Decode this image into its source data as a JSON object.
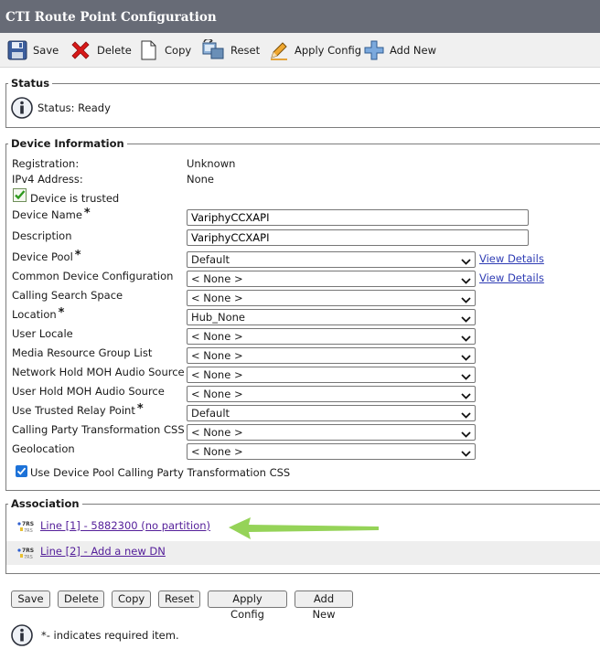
{
  "window": {
    "title": "CTI Route Point Configuration"
  },
  "toolbar": {
    "save": "Save",
    "delete": "Delete",
    "copy": "Copy",
    "reset": "Reset",
    "apply_config": "Apply Config",
    "add_new": "Add New"
  },
  "status": {
    "legend": "Status",
    "text": "Status: Ready"
  },
  "device_info": {
    "legend": "Device Information",
    "registration_label": "Registration:",
    "registration_value": "Unknown",
    "ipv4_label": "IPv4 Address:",
    "ipv4_value": "None",
    "trusted_label": "Device is trusted",
    "device_name_label": "Device Name",
    "device_name_value": "VariphyCCXAPI",
    "description_label": "Description",
    "description_value": "VariphyCCXAPI",
    "required_mark": "*",
    "view_details": "View Details",
    "selects": [
      {
        "label": "Device Pool",
        "value": "Default",
        "required": true,
        "view_details": true
      },
      {
        "label": "Common Device Configuration",
        "value": "< None >",
        "required": false,
        "view_details": true
      },
      {
        "label": "Calling Search Space",
        "value": "< None >",
        "required": false,
        "view_details": false
      },
      {
        "label": "Location",
        "value": "Hub_None",
        "required": true,
        "view_details": false
      },
      {
        "label": "User Locale",
        "value": "< None >",
        "required": false,
        "view_details": false
      },
      {
        "label": "Media Resource Group List",
        "value": "< None >",
        "required": false,
        "view_details": false
      },
      {
        "label": "Network Hold MOH Audio Source",
        "value": "< None >",
        "required": false,
        "view_details": false
      },
      {
        "label": "User Hold MOH Audio Source",
        "value": "< None >",
        "required": false,
        "view_details": false
      },
      {
        "label": "Use Trusted Relay Point",
        "value": "Default",
        "required": true,
        "view_details": false
      },
      {
        "label": "Calling Party Transformation CSS",
        "value": "< None >",
        "required": false,
        "view_details": false
      },
      {
        "label": "Geolocation",
        "value": "< None >",
        "required": false,
        "view_details": false
      }
    ],
    "use_device_pool_css_label": "Use Device Pool Calling Party Transformation CSS",
    "use_device_pool_css_checked": true
  },
  "association": {
    "legend": "Association",
    "lines": [
      "Line [1] - 5882300 (no partition)",
      "Line [2] - Add a new DN"
    ]
  },
  "bottom_buttons": {
    "save": "Save",
    "delete": "Delete",
    "copy": "Copy",
    "reset": "Reset",
    "apply_config": "Apply Config",
    "add_new": "Add New"
  },
  "footer": {
    "required_note": "*- indicates required item."
  },
  "colors": {
    "titlebar_bg": "#676b76",
    "link_blue": "#2e3cb4",
    "link_visited": "#55209a",
    "checkbox_blue": "#1d72d8",
    "arrow_green": "#8fd14f"
  }
}
